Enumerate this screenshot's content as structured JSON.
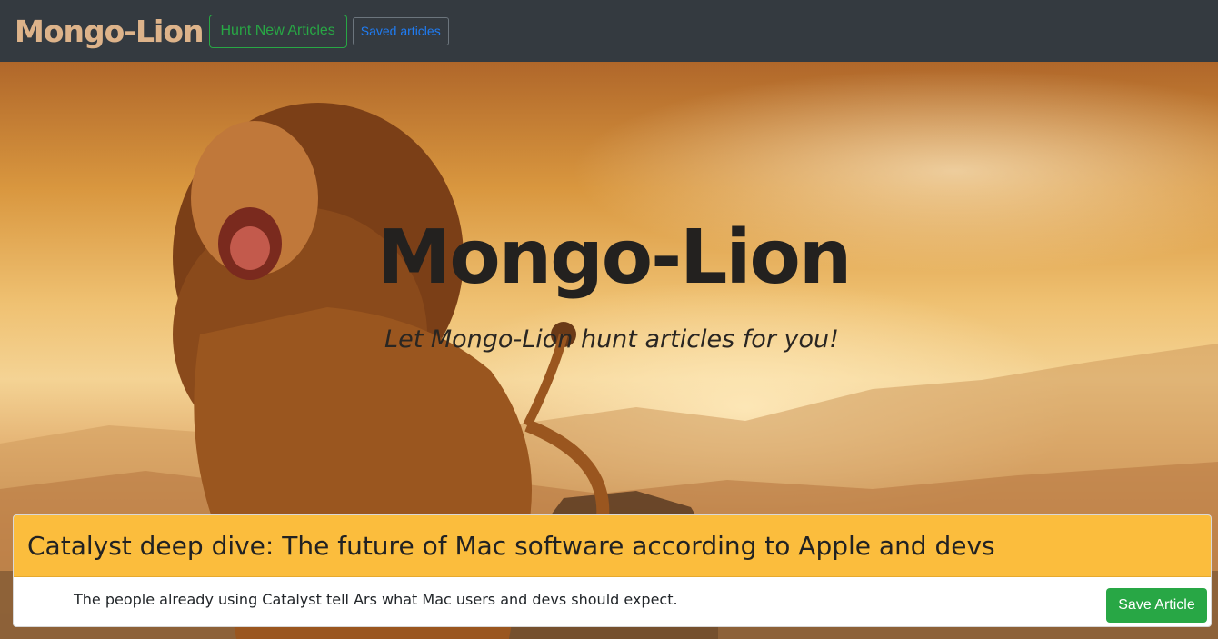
{
  "navbar": {
    "brand": "Mongo-Lion",
    "hunt_button": "Hunt New Articles",
    "saved_button": "Saved articles"
  },
  "hero": {
    "title": "Mongo-Lion",
    "tagline": "Let Mongo-Lion hunt articles for you!",
    "background_image": "roaring-lion-savanna-sunset"
  },
  "articles": [
    {
      "title": "Catalyst deep dive: The future of Mac software according to Apple and devs",
      "summary": "The people already using Catalyst tell Ars what Mac users and devs should expect.",
      "save_label": "Save Article"
    }
  ],
  "colors": {
    "navbar_bg": "#343a40",
    "brand": "#ddb38a",
    "success": "#28a745",
    "primary": "#1f7cf3",
    "card_header": "#fbbd3d"
  }
}
